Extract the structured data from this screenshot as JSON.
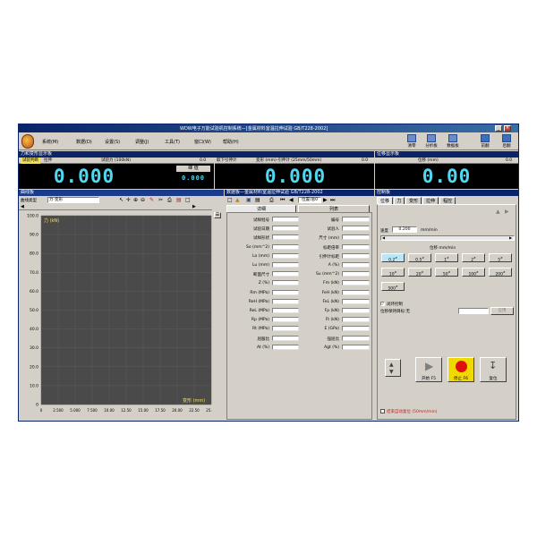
{
  "app": {
    "title": "WDW电子万能试验机控制系统—[金属材料室温拉伸试验 GB/T228-2002]",
    "window_controls": [
      "_",
      "□",
      "×"
    ]
  },
  "menubar": {
    "items": [
      "系统(M)",
      "数据(D)",
      "设置(S)",
      "调整(J)",
      "工具(T)",
      "窗口(W)",
      "帮助(H)"
    ]
  },
  "toolbar": {
    "buttons": [
      "清零",
      "分析板",
      "数据板",
      "前翻",
      "后翻"
    ]
  },
  "force_panel": {
    "title": "力和变形显示板",
    "tab_active": "试验判断",
    "tab2": "拉伸",
    "header": "试验力 (100kN)",
    "header_value": "0.0",
    "value": "0.000",
    "peak_label": "峰 值",
    "peak_value": "0.000"
  },
  "deform_panel": {
    "header1": "取下引伸计",
    "header2": "变形 (mm)-引伸计 (25mm/50mm)",
    "header_value": "0.0",
    "value": "0.000"
  },
  "displacement_panel": {
    "title": "位移显示板",
    "header": "位移 (mm)",
    "header_value": "0.0",
    "value": "0.00"
  },
  "curve_panel": {
    "title": "曲线板",
    "type_label": "曲线类型",
    "type_value": "力-变形",
    "y_axis_label": "力 (kN)",
    "x_axis_label": "变形 (mm)"
  },
  "chart_data": {
    "type": "line",
    "ylabel": "力 (kN)",
    "xlabel": "变形 (mm)",
    "ylim": [
      0,
      100
    ],
    "xlim": [
      0,
      25
    ],
    "yticks": [
      "100.0",
      "90.0",
      "80.0",
      "70.0",
      "60.0",
      "50.0",
      "40.0",
      "30.0",
      "20.0",
      "10.0",
      "0"
    ],
    "xticks": [
      "0",
      "2.500",
      "5.000",
      "7.500",
      "10.00",
      "12.50",
      "15.00",
      "17.50",
      "20.00",
      "22.50",
      "25.00"
    ],
    "grid": true,
    "series": []
  },
  "data_panel": {
    "title": "数据板—金属材料室温拉伸试验 GB/T228-2002",
    "nav": "位置/总0",
    "tab_detail": "详细",
    "tab_list": "列表",
    "left_fields": [
      "试样批号",
      "试验日期",
      "试样形状",
      "So (mm^2)",
      "Lo (mm)",
      "Lu (mm)",
      "断面尺寸",
      "Z (%)",
      "Rm (MPa)",
      "ReH (MPa)",
      "ReL (MPa)",
      "Rp (MPa)",
      "Rt (MPa)",
      "屈服比",
      "At (%)"
    ],
    "right_fields": [
      "编号",
      "试验人",
      "尺寸 (mm)",
      "标距倍率",
      "引伸计标距",
      "A (%)",
      "Su (mm^2)",
      "Fm (kN)",
      "FeH (kN)",
      "FeL (kN)",
      "Fp (kN)",
      "Ft (kN)",
      "E (GPa)",
      "强屈比",
      "Agt (%)"
    ]
  },
  "control_panel": {
    "title": "控制板",
    "tabs": [
      "位移",
      "力",
      "变形",
      "拉伸",
      "程控"
    ],
    "speed_label": "速度",
    "speed_value": "0.200",
    "speed_unit": "mm/min",
    "displacement_header": "位移 mm/min",
    "speed_buttons": [
      "0.2",
      "0.5",
      "1",
      "2",
      "5",
      "10",
      "20",
      "50",
      "100",
      "200",
      "500"
    ],
    "selected_speed": "0.2",
    "closed_loop_label": "闭环控制",
    "hold_label": "位移保持目标:无",
    "apply_label": "应用",
    "up_label": "上",
    "start_label": "开始 F5",
    "stop_label": "停止 F6",
    "reset_label": "复位",
    "auto_reset_label": "结束自动复位 (50mm/min)"
  },
  "colors": {
    "lcd_text": "#4fd8f0",
    "plot_bg": "#4a4a4a",
    "grid": "#5c5c5c",
    "title_bar": "#0a246a",
    "stop_button": "#f0d800",
    "stop_icon": "#e01010"
  }
}
